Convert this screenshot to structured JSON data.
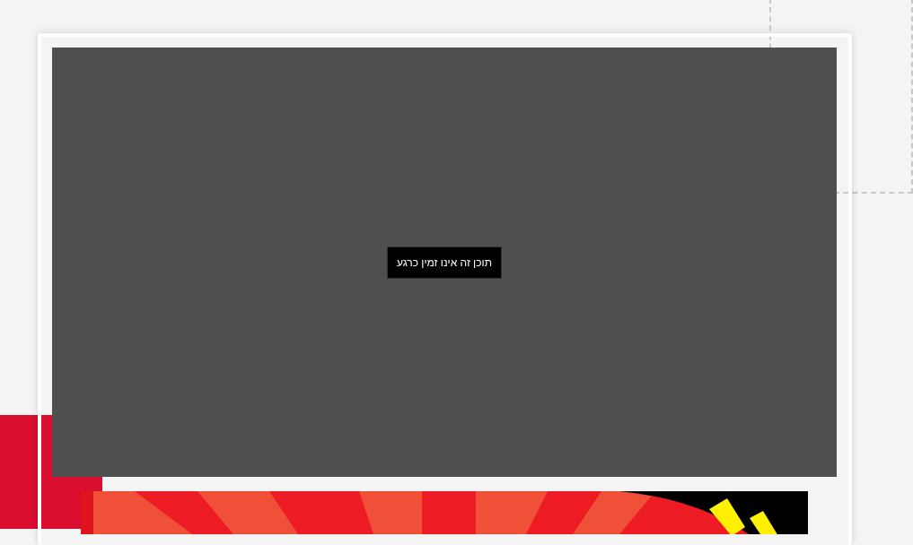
{
  "video_player": {
    "message": "תוכן זה אינו זמין כרגע"
  }
}
